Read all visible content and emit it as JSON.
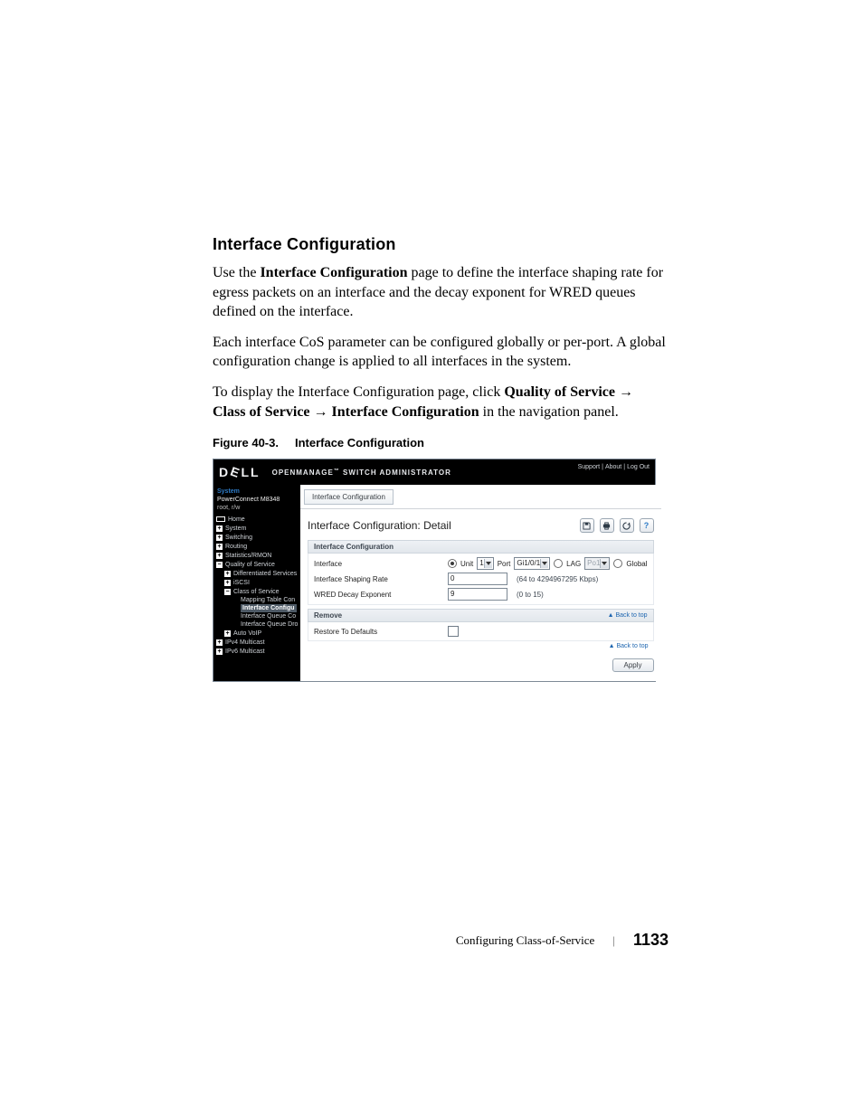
{
  "heading": "Interface Configuration",
  "para1_a": "Use the ",
  "para1_b": "Interface Configuration",
  "para1_c": " page to define the interface shaping rate for egress packets on an interface and the decay exponent for WRED queues defined on the interface.",
  "para2": "Each interface CoS parameter can be configured globally or per-port. A global configuration change is applied to all interfaces in the system.",
  "para3_a": "To display the Interface Configuration page, click ",
  "para3_b": "Quality of Service",
  "para3_arrow": " → ",
  "para3_c": "Class of Service",
  "para3_d": "Interface Configuration",
  "para3_e": " in the navigation panel.",
  "figcap_a": "Figure 40-3.",
  "figcap_b": "Interface Configuration",
  "shot": {
    "brand": {
      "d": "D",
      "e": "E",
      "l1": "L",
      "l2": "L"
    },
    "appname_a": "OPENMANAGE",
    "appname_tm": "™",
    "appname_b": " SWITCH ADMINISTRATOR",
    "toplinks": {
      "support": "Support",
      "about": "About",
      "logout": "Log Out"
    },
    "nav": {
      "system": "System",
      "device": "PowerConnect M8348",
      "user": "root, r/w",
      "home": "Home",
      "items": [
        {
          "label": "System"
        },
        {
          "label": "Switching"
        },
        {
          "label": "Routing"
        },
        {
          "label": "Statistics/RMON"
        },
        {
          "label": "Quality of Service"
        }
      ],
      "qos_children": [
        {
          "label": "Differentiated Services"
        },
        {
          "label": "iSCSI"
        },
        {
          "label": "Class of Service"
        }
      ],
      "cos_children": [
        {
          "label": "Mapping Table Con"
        },
        {
          "label": "Interface Configu",
          "active": true
        },
        {
          "label": "Interface Queue Co"
        },
        {
          "label": "Interface Queue Dro"
        }
      ],
      "qos_after": {
        "label": "Auto VoIP"
      },
      "tail": [
        {
          "label": "IPv4 Multicast"
        },
        {
          "label": "IPv6 Multicast"
        }
      ]
    },
    "crumb": "Interface Configuration",
    "detail_title": "Interface Configuration: Detail",
    "section1": "Interface Configuration",
    "rows": {
      "interface": {
        "label": "Interface",
        "unit_label": "Unit",
        "unit_value": "1",
        "port_label": "Port",
        "port_value": "Gi1/0/1",
        "lag_label": "LAG",
        "lag_value": "Po1",
        "global_label": "Global"
      },
      "shaping": {
        "label": "Interface Shaping Rate",
        "value": "0",
        "hint": "(64 to 4294967295 Kbps)"
      },
      "wred": {
        "label": "WRED Decay Exponent",
        "value": "9",
        "hint": "(0 to 15)"
      }
    },
    "section2_label": "Remove",
    "restore_label": "Restore To Defaults",
    "backtop": "Back to top",
    "apply": "Apply"
  },
  "footer": {
    "label": "Configuring Class-of-Service",
    "page": "1133"
  }
}
